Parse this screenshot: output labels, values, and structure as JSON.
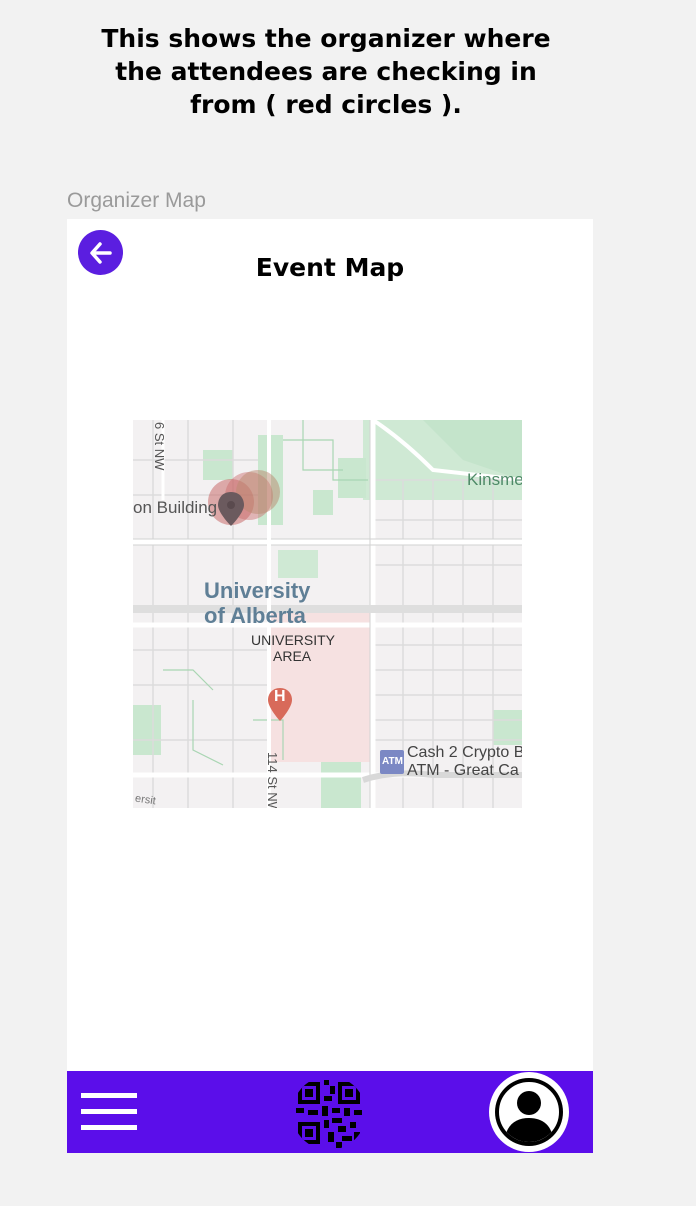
{
  "caption": "This shows the organizer where the attendees are checking in from ( red circles ).",
  "frame_label": "Organizer Map",
  "header": {
    "title": "Event Map"
  },
  "map": {
    "labels": {
      "street_106": "6 St NW",
      "building": "on Building",
      "kinsmen": "Kinsme",
      "university_line1": "University",
      "university_line2": "of Alberta",
      "area_line1": "UNIVERSITY",
      "area_line2": "AREA",
      "street_114": "114 St NW",
      "atm_badge": "ATM",
      "atm_line1": "Cash 2 Crypto B",
      "atm_line2": "ATM - Great Ca",
      "bottom_left": "ersit",
      "hospital": "H"
    },
    "colors": {
      "checkin_circle": "#c96b6b",
      "park": "#c9e7cf",
      "campus_area": "#f6e1e1",
      "road": "#ffffff"
    }
  },
  "nav": {
    "accent": "#5b0eea",
    "menu_icon": "hamburger-menu-icon",
    "qr_icon": "qr-code-icon",
    "profile_icon": "user-avatar-icon"
  }
}
